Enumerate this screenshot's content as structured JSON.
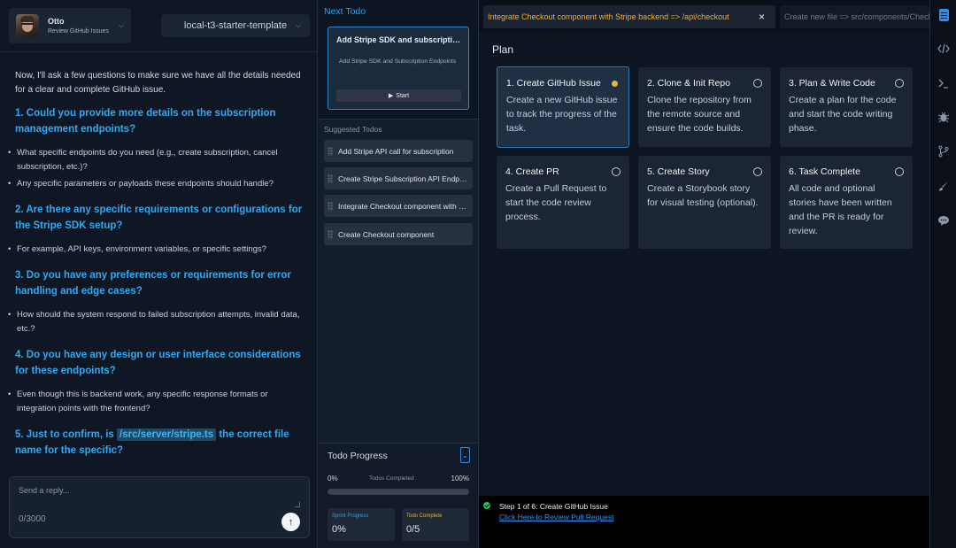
{
  "user": {
    "name": "Otto",
    "status": "Review GitHub Issues"
  },
  "repo": {
    "selected": "local-t3-starter-template"
  },
  "chat": {
    "intro": "Now, I'll ask a few questions to make sure we have all the details needed for a clear and complete GitHub issue.",
    "q1": "1. Could you provide more details on the subscription management endpoints?",
    "q1_b1": "What specific endpoints do you need (e.g., create subscription, cancel subscription, etc.)?",
    "q1_b2": "Any specific parameters or payloads these endpoints should handle?",
    "q2": "2. Are there any specific requirements or configurations for the Stripe SDK setup?",
    "q2_b1": "For example, API keys, environment variables, or specific settings?",
    "q3": "3. Do you have any preferences or requirements for error handling and edge cases?",
    "q3_b1": "How should the system respond to failed subscription attempts, invalid data, etc.?",
    "q4": "4. Do you have any design or user interface considerations for these endpoints?",
    "q4_b1": "Even though this is backend work, any specific response formats or integration points with the frontend?",
    "q5_pre": "5. Just to confirm, is ",
    "q5_code": "/src/server/stripe.ts",
    "q5_post": " the correct file name for the specific?"
  },
  "reply": {
    "placeholder": "Send a reply...",
    "count": "0/3000"
  },
  "next_todo": {
    "heading": "Next Todo",
    "title": "Add Stripe SDK and subscription management endpoints",
    "description": "Add Stripe SDK and Subscription Endpoints",
    "start_label": "Start"
  },
  "suggested": {
    "heading": "Suggested Todos",
    "items": [
      "Add Stripe API call for subscription",
      "Create Stripe Subscription API Endpoint",
      "Integrate Checkout component with Stripe backend",
      "Create Checkout component"
    ]
  },
  "progress": {
    "title": "Todo Progress",
    "min": "0%",
    "label": "Todos Completed",
    "max": "100%",
    "fraction": 0,
    "sprint_label": "Sprint Progress",
    "sprint_value": "0%",
    "complete_label": "Todo Complete",
    "complete_value": "0/5",
    "colors": {
      "sprint": "#2aa3ee",
      "complete": "#f2b01e"
    }
  },
  "tabs": {
    "active": "Integrate Checkout component with Stripe backend => /api/checkout",
    "second": "Create new file => src/components/Checkout"
  },
  "plan": {
    "title": "Plan",
    "steps": [
      {
        "name": "1. Create GitHub Issue",
        "desc": "Create a new GitHub issue to track the progress of the task.",
        "active": true
      },
      {
        "name": "2. Clone & Init Repo",
        "desc": "Clone the repository from the remote source and ensure the code builds."
      },
      {
        "name": "3. Plan & Write Code",
        "desc": "Create a plan for the code and start the code writing phase."
      },
      {
        "name": "4. Create PR",
        "desc": "Create a Pull Request to start the code review process."
      },
      {
        "name": "5. Create Story",
        "desc": "Create a Storybook story for visual testing (optional)."
      },
      {
        "name": "6. Task Complete",
        "desc": "All code and optional stories have been written and the PR is ready for review."
      }
    ]
  },
  "footer": {
    "step": "Step 1 of 6: Create GitHub Issue",
    "link": "Click Here to Review Pull Request"
  },
  "rail": [
    "document-icon",
    "code-icon",
    "terminal-icon",
    "bug-icon",
    "branch-icon",
    "brush-icon",
    "chat-icon"
  ],
  "colors": {
    "accent": "#2aa3ee",
    "tab_active_text": "#f2b01e",
    "step_active_dot": "#e6b43a",
    "check": "#29c35f"
  }
}
